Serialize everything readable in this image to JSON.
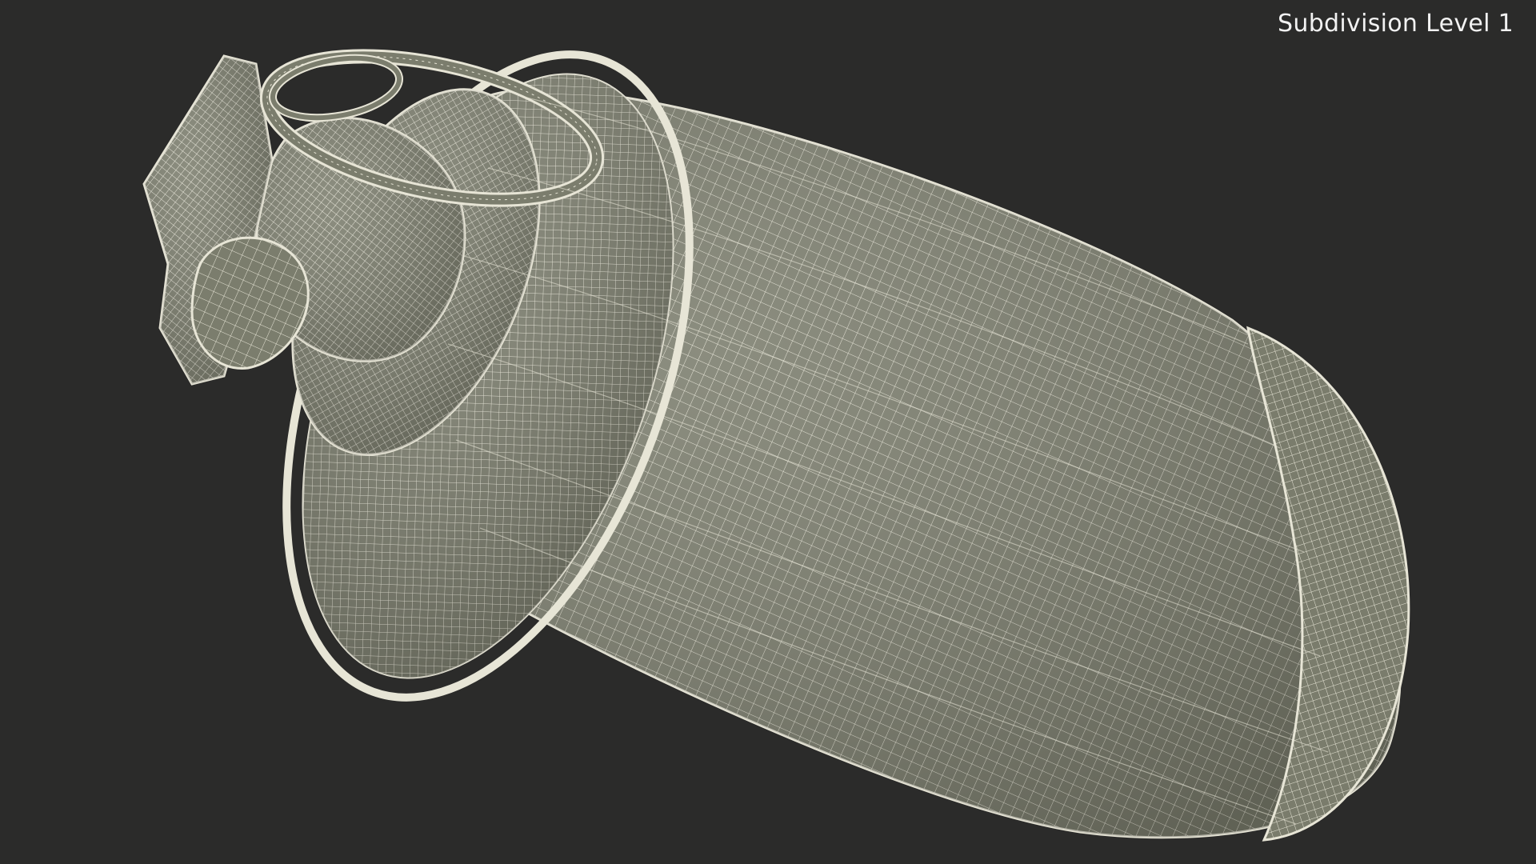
{
  "viewport": {
    "label": "Subdivision Level 1"
  },
  "colors": {
    "background": "#2b2b2a",
    "surface": "#7b7d6d",
    "wire": "#e7e5d6",
    "label": "#f2f2f2"
  },
  "model": {
    "icon": "smoke-grenade-wireframe-icon"
  }
}
